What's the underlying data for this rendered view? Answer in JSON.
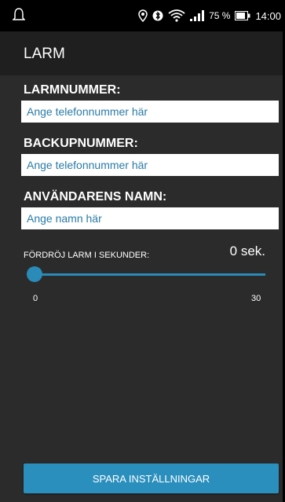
{
  "status_bar": {
    "battery_percent": "75 %",
    "time": "14:00",
    "icons": [
      "notification-icon",
      "location-icon",
      "bluetooth-icon",
      "wifi-icon",
      "signal-icon",
      "battery-icon"
    ]
  },
  "app_bar": {
    "title": "LARM"
  },
  "form": {
    "alarm_number": {
      "label": "LARMNUMMER:",
      "placeholder": "Ange telefonnummer här",
      "value": ""
    },
    "backup_number": {
      "label": "BACKUPNUMMER:",
      "placeholder": "Ange telefonnummer här",
      "value": ""
    },
    "user_name": {
      "label": "ANVÄNDARENS NAMN:",
      "placeholder": "Ange namn här",
      "value": ""
    },
    "delay": {
      "label": "FÖRDRÖJ LARM I SEKUNDER:",
      "value_text": "0 sek.",
      "min": "0",
      "max": "30",
      "value": 0
    }
  },
  "actions": {
    "save_label": "SPARA INSTÄLLNINGAR"
  },
  "colors": {
    "accent": "#2b8fbd",
    "input_text": "#2a7ba7",
    "background": "#2b2b2b",
    "appbar": "#1f1f1f"
  }
}
